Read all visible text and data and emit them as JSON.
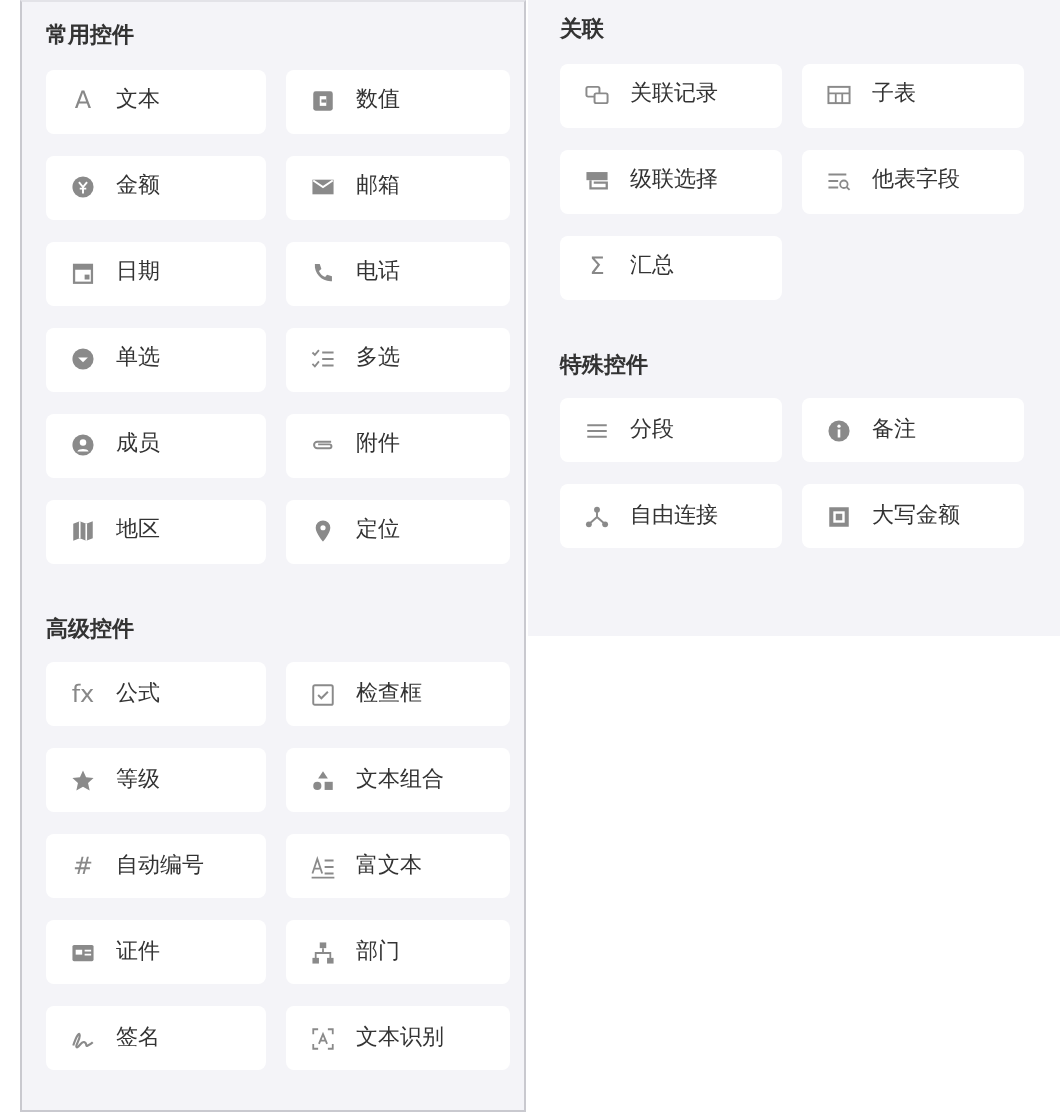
{
  "left_panel": {
    "sections": [
      {
        "title": "常用控件",
        "items": [
          {
            "glyph": "A",
            "label": "文本"
          },
          {
            "label": "数值"
          },
          {
            "label": "金额"
          },
          {
            "label": "邮箱"
          },
          {
            "label": "日期"
          },
          {
            "label": "电话"
          },
          {
            "label": "单选"
          },
          {
            "label": "多选"
          },
          {
            "label": "成员"
          },
          {
            "label": "附件"
          },
          {
            "label": "地区"
          },
          {
            "label": "定位"
          }
        ]
      },
      {
        "title": "高级控件",
        "items": [
          {
            "glyph": "fx",
            "label": "公式"
          },
          {
            "label": "检查框"
          },
          {
            "label": "等级"
          },
          {
            "label": "文本组合"
          },
          {
            "glyph": "#",
            "label": "自动编号"
          },
          {
            "label": "富文本"
          },
          {
            "label": "证件"
          },
          {
            "label": "部门"
          },
          {
            "label": "签名"
          },
          {
            "label": "文本识别"
          }
        ]
      }
    ]
  },
  "right_panel": {
    "sections": [
      {
        "title": "关联",
        "items": [
          {
            "label": "关联记录"
          },
          {
            "label": "子表"
          },
          {
            "label": "级联选择"
          },
          {
            "label": "他表字段"
          },
          {
            "glyph": "Σ",
            "label": "汇总"
          }
        ]
      },
      {
        "title": "特殊控件",
        "items": [
          {
            "label": "分段"
          },
          {
            "label": "备注"
          },
          {
            "label": "自由连接"
          },
          {
            "label": "大写金额"
          }
        ]
      }
    ]
  }
}
